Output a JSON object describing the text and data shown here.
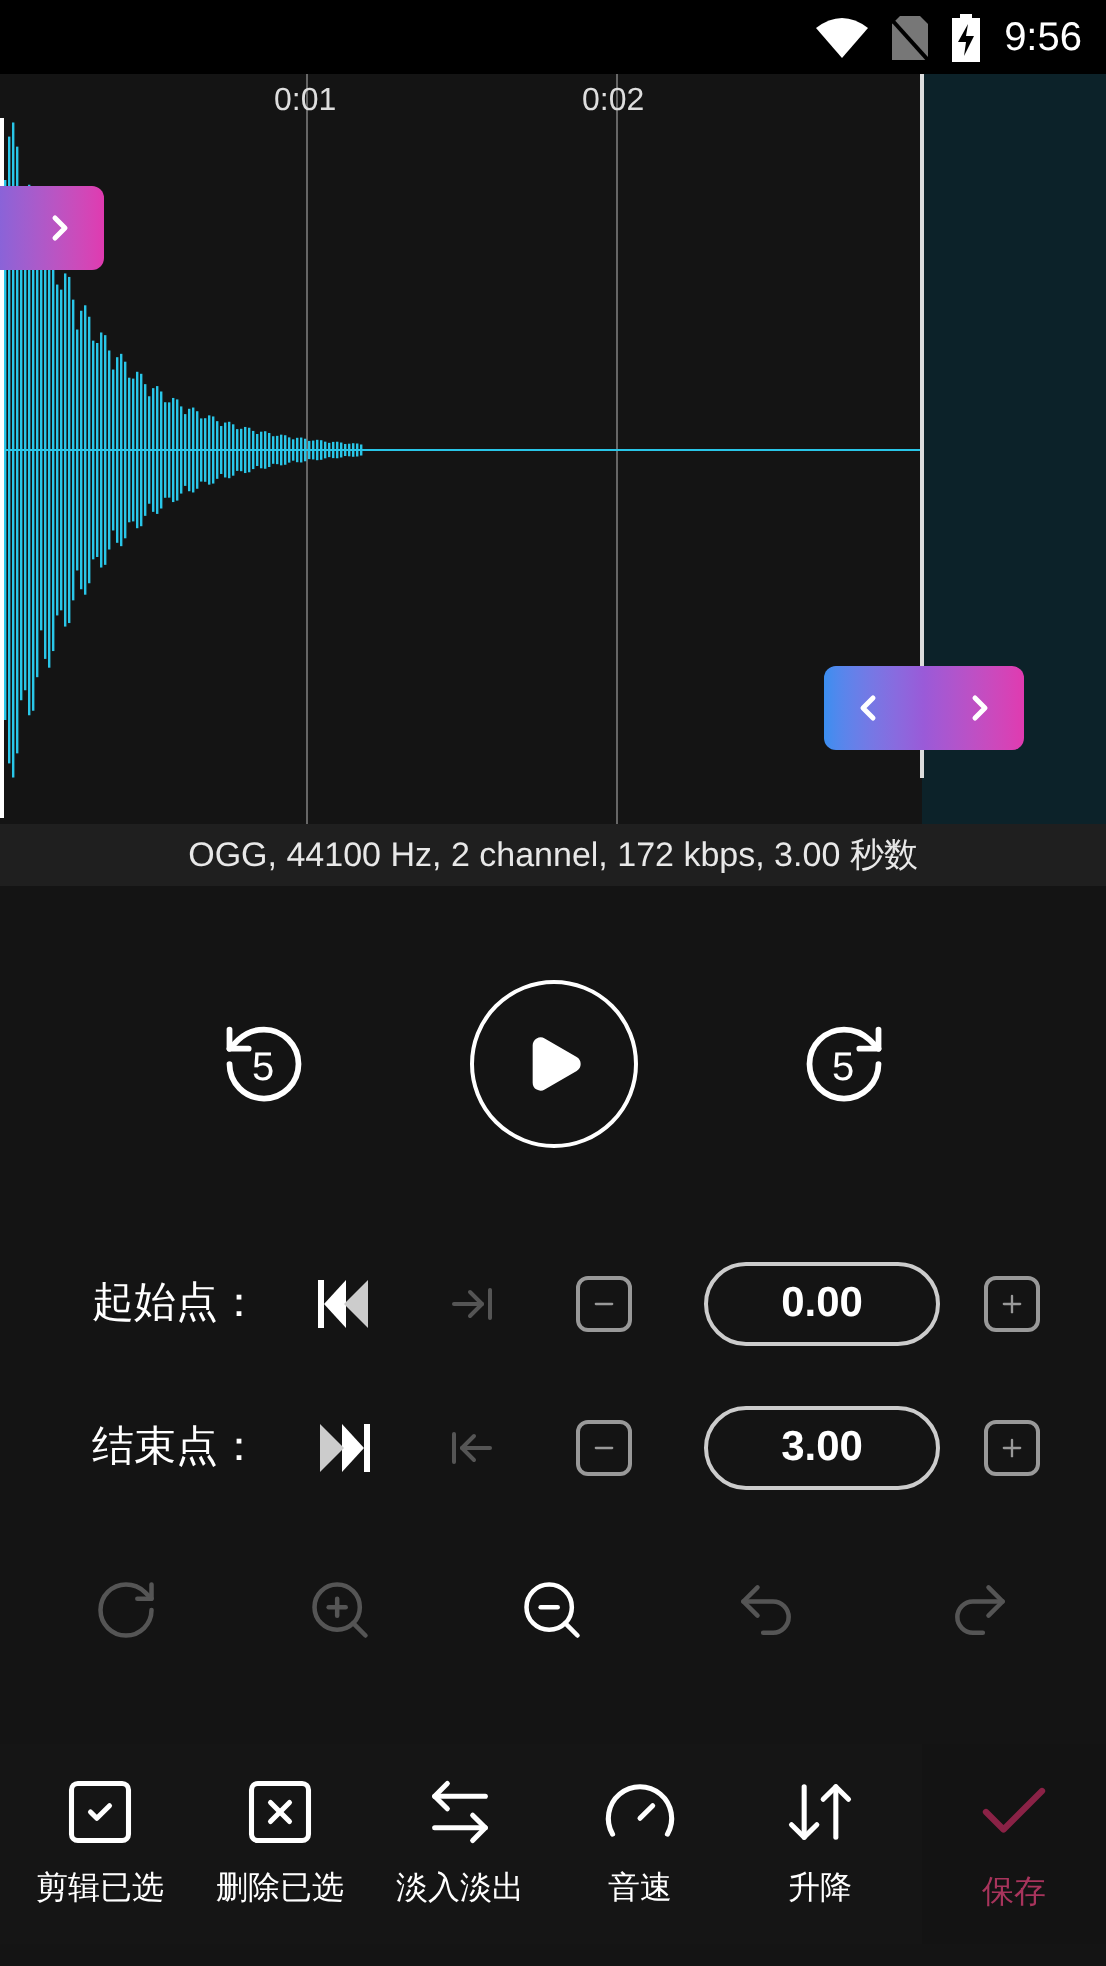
{
  "status_bar": {
    "time": "9:56"
  },
  "timeline": {
    "ticks": [
      "0:01",
      "0:02"
    ]
  },
  "info": "OGG, 44100 Hz, 2 channel, 172 kbps, 3.00 秒数",
  "playback": {
    "back": "5",
    "forward": "5"
  },
  "markers": [
    {
      "kind": "start",
      "label": "起始点：",
      "value": "0.00",
      "jump_disabled": true
    },
    {
      "kind": "end",
      "label": "结束点：",
      "value": "3.00",
      "jump_disabled": true
    }
  ],
  "tools": [
    {
      "kind": "reset",
      "disabled": true
    },
    {
      "kind": "zoom-in",
      "disabled": true
    },
    {
      "kind": "zoom-out",
      "disabled": false
    },
    {
      "kind": "undo",
      "disabled": true
    },
    {
      "kind": "redo",
      "disabled": true
    }
  ],
  "actions": [
    {
      "kind": "trim",
      "label": "剪辑已选"
    },
    {
      "kind": "delete",
      "label": "删除已选"
    },
    {
      "kind": "fade",
      "label": "淡入淡出"
    },
    {
      "kind": "speed",
      "label": "音速"
    },
    {
      "kind": "pitch",
      "label": "升降"
    }
  ],
  "save": {
    "label": "保存",
    "disabled": true
  }
}
